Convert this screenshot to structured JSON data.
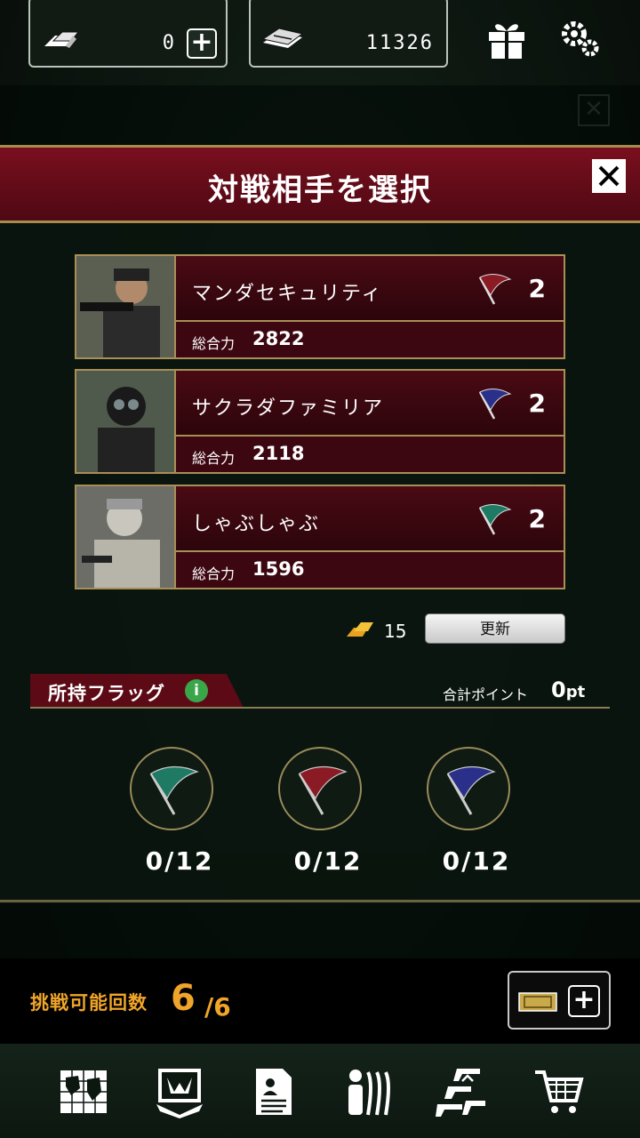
{
  "currency": {
    "gold_value": "0",
    "cash_value": "11326"
  },
  "icons": [
    "gold-bars-icon",
    "cash-stack-icon",
    "gift-icon",
    "gear-icon",
    "close-icon",
    "flag-icon",
    "info-icon",
    "ticket-icon",
    "map-icon",
    "ranking-emblem-icon",
    "document-icon",
    "squad-icon",
    "stairs-icon",
    "cart-icon"
  ],
  "modal": {
    "title": "対戦相手を選択"
  },
  "opponents": [
    {
      "name": "マンダセキュリティ",
      "power_label": "総合力",
      "power": "2822",
      "flag_color": "#8a1a24",
      "flag_count": "2"
    },
    {
      "name": "サクラダファミリア",
      "power_label": "総合力",
      "power": "2118",
      "flag_color": "#2a2f8a",
      "flag_count": "2"
    },
    {
      "name": "しゃぶしゃぶ",
      "power_label": "総合力",
      "power": "1596",
      "flag_color": "#1f7a64",
      "flag_count": "2"
    }
  ],
  "refresh": {
    "cost": "15",
    "button_label": "更新"
  },
  "flags_section": {
    "title": "所持フラッグ",
    "info": "i",
    "total_label": "合計ポイント",
    "total_value": "0",
    "total_unit": "pt",
    "flags": [
      {
        "color": "#1f7a64",
        "count": "0/12"
      },
      {
        "color": "#8a1a24",
        "count": "0/12"
      },
      {
        "color": "#2a2f8a",
        "count": "0/12"
      }
    ]
  },
  "challenge": {
    "label": "挑戦可能回数",
    "current": "6",
    "max": "/6"
  },
  "colors": {
    "accent_gold": "#f0a52a",
    "header_red": "#7a0f1e",
    "border_gold": "#a98f55"
  }
}
